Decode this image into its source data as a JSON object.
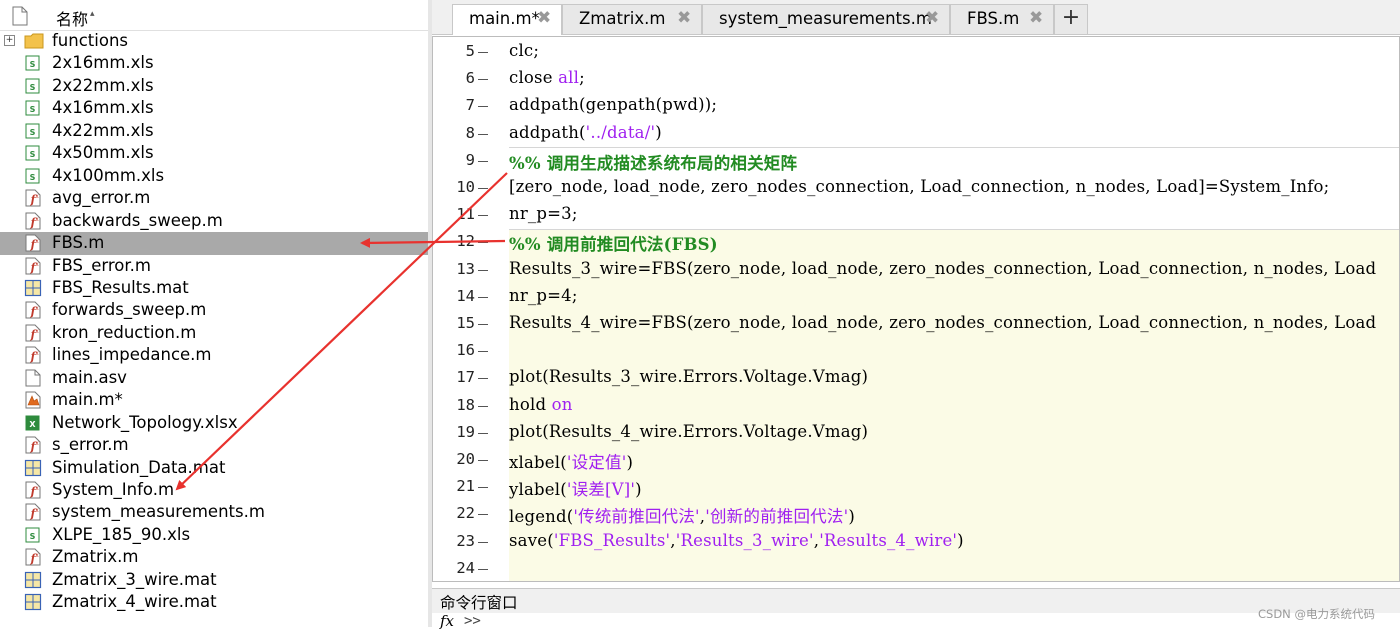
{
  "browser": {
    "header_label": "名称",
    "files": [
      {
        "name": "functions",
        "type": "folder",
        "expandable": true
      },
      {
        "name": "2x16mm.xls",
        "type": "xls"
      },
      {
        "name": "2x22mm.xls",
        "type": "xls"
      },
      {
        "name": "4x16mm.xls",
        "type": "xls"
      },
      {
        "name": "4x22mm.xls",
        "type": "xls"
      },
      {
        "name": "4x50mm.xls",
        "type": "xls"
      },
      {
        "name": "4x100mm.xls",
        "type": "xls"
      },
      {
        "name": "avg_error.m",
        "type": "m"
      },
      {
        "name": "backwards_sweep.m",
        "type": "m"
      },
      {
        "name": "FBS.m",
        "type": "m",
        "selected": true
      },
      {
        "name": "FBS_error.m",
        "type": "m"
      },
      {
        "name": "FBS_Results.mat",
        "type": "mat"
      },
      {
        "name": "forwards_sweep.m",
        "type": "m"
      },
      {
        "name": "kron_reduction.m",
        "type": "m"
      },
      {
        "name": "lines_impedance.m",
        "type": "m"
      },
      {
        "name": "main.asv",
        "type": "asv"
      },
      {
        "name": "main.m*",
        "type": "mlive"
      },
      {
        "name": "Network_Topology.xlsx",
        "type": "xlsx"
      },
      {
        "name": "s_error.m",
        "type": "m"
      },
      {
        "name": "Simulation_Data.mat",
        "type": "mat"
      },
      {
        "name": "System_Info.m",
        "type": "m"
      },
      {
        "name": "system_measurements.m",
        "type": "m"
      },
      {
        "name": "XLPE_185_90.xls",
        "type": "xls"
      },
      {
        "name": "Zmatrix.m",
        "type": "m"
      },
      {
        "name": "Zmatrix_3_wire.mat",
        "type": "mat"
      },
      {
        "name": "Zmatrix_4_wire.mat",
        "type": "mat"
      }
    ]
  },
  "tabs": [
    {
      "label": "main.m*",
      "active": true
    },
    {
      "label": "Zmatrix.m",
      "active": false
    },
    {
      "label": "system_measurements.m",
      "active": false
    },
    {
      "label": "FBS.m",
      "active": false
    }
  ],
  "tab_add_label": "+",
  "tab_close_glyph": "✖",
  "code_lines": [
    {
      "n": "5",
      "parts": [
        {
          "t": "clc;",
          "c": ""
        }
      ]
    },
    {
      "n": "6",
      "parts": [
        {
          "t": "close ",
          "c": ""
        },
        {
          "t": "all",
          "c": "str"
        },
        {
          "t": ";",
          "c": ""
        }
      ]
    },
    {
      "n": "7",
      "parts": [
        {
          "t": "addpath(genpath(pwd));",
          "c": ""
        }
      ]
    },
    {
      "n": "8",
      "parts": [
        {
          "t": "addpath(",
          "c": ""
        },
        {
          "t": "'../data/'",
          "c": "str"
        },
        {
          "t": ")",
          "c": ""
        }
      ]
    },
    {
      "n": "9",
      "parts": [
        {
          "t": "%% 调用生成描述系统布局的相关矩阵",
          "c": "cmt"
        }
      ]
    },
    {
      "n": "10",
      "parts": [
        {
          "t": "[zero_node, load_node, zero_nodes_connection, Load_connection, n_nodes, Load]=System_Info;",
          "c": ""
        }
      ]
    },
    {
      "n": "11",
      "parts": [
        {
          "t": "nr_p=3;",
          "c": ""
        }
      ]
    },
    {
      "n": "12",
      "parts": [
        {
          "t": "%% 调用前推回代法(FBS)",
          "c": "cmt"
        }
      ]
    },
    {
      "n": "13",
      "parts": [
        {
          "t": "Results_3_wire=FBS(zero_node, load_node, zero_nodes_connection, Load_connection, n_nodes, Load",
          "c": ""
        }
      ]
    },
    {
      "n": "14",
      "parts": [
        {
          "t": "nr_p=4;",
          "c": ""
        }
      ]
    },
    {
      "n": "15",
      "parts": [
        {
          "t": "Results_4_wire=FBS(zero_node, load_node, zero_nodes_connection, Load_connection, n_nodes, Load",
          "c": ""
        }
      ]
    },
    {
      "n": "16",
      "parts": []
    },
    {
      "n": "17",
      "parts": [
        {
          "t": "plot(Results_3_wire.Errors.Voltage.Vmag)",
          "c": ""
        }
      ]
    },
    {
      "n": "18",
      "parts": [
        {
          "t": "hold ",
          "c": ""
        },
        {
          "t": "on",
          "c": "str"
        }
      ]
    },
    {
      "n": "19",
      "parts": [
        {
          "t": "plot(Results_4_wire.Errors.Voltage.Vmag)",
          "c": ""
        }
      ]
    },
    {
      "n": "20",
      "parts": [
        {
          "t": "xlabel(",
          "c": ""
        },
        {
          "t": "'设定值'",
          "c": "str"
        },
        {
          "t": ")",
          "c": ""
        }
      ]
    },
    {
      "n": "21",
      "parts": [
        {
          "t": "ylabel(",
          "c": ""
        },
        {
          "t": "'误差[V]'",
          "c": "str"
        },
        {
          "t": ")",
          "c": ""
        }
      ]
    },
    {
      "n": "22",
      "parts": [
        {
          "t": "legend(",
          "c": ""
        },
        {
          "t": "'传统前推回代法'",
          "c": "str"
        },
        {
          "t": ",",
          "c": ""
        },
        {
          "t": "'创新的前推回代法'",
          "c": "str"
        },
        {
          "t": ")",
          "c": ""
        }
      ]
    },
    {
      "n": "23",
      "parts": [
        {
          "t": "save(",
          "c": ""
        },
        {
          "t": "'FBS_Results'",
          "c": "str"
        },
        {
          "t": ",",
          "c": ""
        },
        {
          "t": "'Results_3_wire'",
          "c": "str"
        },
        {
          "t": ",",
          "c": ""
        },
        {
          "t": "'Results_4_wire'",
          "c": "str"
        },
        {
          "t": ")",
          "c": ""
        }
      ]
    },
    {
      "n": "24",
      "parts": []
    }
  ],
  "command_window": {
    "title": "命令行窗口",
    "prompt_icon": "fx",
    "prompt": ">>"
  },
  "watermark": "CSDN @电力系统代码",
  "colors": {
    "selection": "#a9a9a9",
    "string": "#a020f0",
    "comment": "#228b22",
    "cell_highlight": "#fbfbe6",
    "annotation_arrow": "#e8322e"
  }
}
